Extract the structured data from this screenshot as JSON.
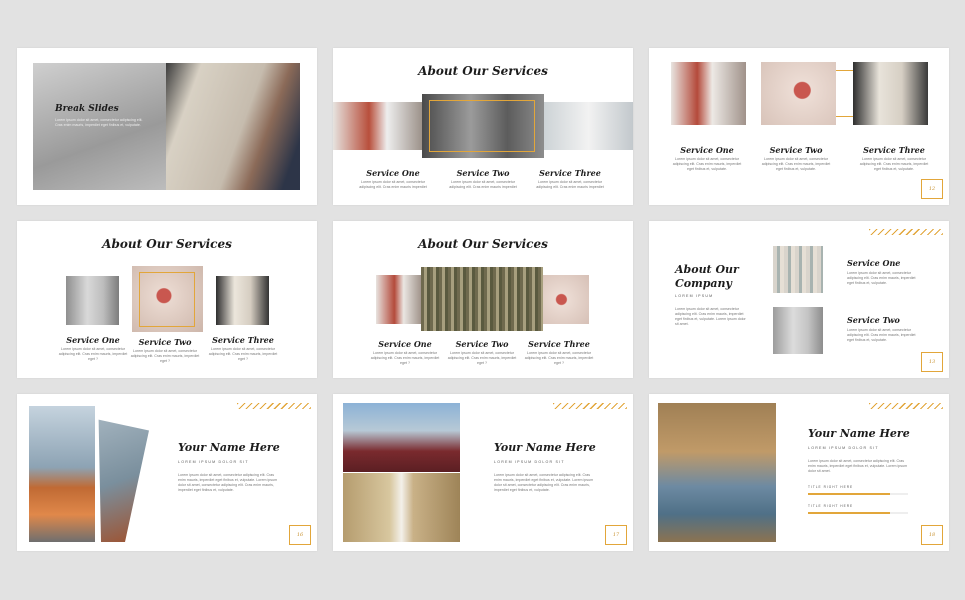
{
  "slides": {
    "s1": {
      "title": "Break Slides",
      "desc": "Lorem ipsum dolor sit amet, consectetur adipiscing elit. Cras enim mauris, imperdiet eget finibus et, vulputate."
    },
    "s2": {
      "title": "About Our Services",
      "services": [
        {
          "name": "Service One",
          "desc": "Lorem ipsum dolor sit amet, consectetur adipiscing elit. Cras enim mauris imperdiet"
        },
        {
          "name": "Service Two",
          "desc": "Lorem ipsum dolor sit amet, consectetur adipiscing elit. Cras enim mauris imperdiet"
        },
        {
          "name": "Service Three",
          "desc": "Lorem ipsum dolor sit amet, consectetur adipiscing elit. Cras enim mauris imperdiet"
        }
      ]
    },
    "s3": {
      "page": "12",
      "services": [
        {
          "name": "Service One",
          "desc": "Lorem ipsum dolor sit amet, consectetur adipiscing elit. Cras enim mauris, imperdiet eget finibus et, vulputate."
        },
        {
          "name": "Service Two",
          "desc": "Lorem ipsum dolor sit amet, consectetur adipiscing elit. Cras enim mauris, imperdiet eget finibus et, vulputate."
        },
        {
          "name": "Service Three",
          "desc": "Lorem ipsum dolor sit amet, consectetur adipiscing elit. Cras enim mauris, imperdiet eget finibus et, vulputate."
        }
      ]
    },
    "s4": {
      "title": "About Our Services",
      "services": [
        {
          "name": "Service One",
          "desc": "Lorem ipsum dolor sit amet, consectetur adipiscing elit. Cras enim mauris, imperdiet eget ?"
        },
        {
          "name": "Service Two",
          "desc": "Lorem ipsum dolor sit amet, consectetur adipiscing elit. Cras enim mauris, imperdiet eget ?"
        },
        {
          "name": "Service Three",
          "desc": "Lorem ipsum dolor sit amet, consectetur adipiscing elit. Cras enim mauris, imperdiet eget ?"
        }
      ]
    },
    "s5": {
      "title": "About Our Services",
      "services": [
        {
          "name": "Service One",
          "desc": "Lorem ipsum dolor sit amet, consectetur adipiscing elit. Cras enim mauris, imperdiet eget ?"
        },
        {
          "name": "Service Two",
          "desc": "Lorem ipsum dolor sit amet, consectetur adipiscing elit. Cras enim mauris, imperdiet eget ?"
        },
        {
          "name": "Service Three",
          "desc": "Lorem ipsum dolor sit amet, consectetur adipiscing elit. Cras enim mauris, imperdiet eget ?"
        }
      ]
    },
    "s6": {
      "title_line1": "About Our",
      "title_line2": "Company",
      "subtitle": "LOREM IPSUM",
      "desc": "Lorem ipsum dolor sit amet, consectetur adipiscing elit. Cras enim mauris, imperdiet eget finibus et, vulputate. Lorem ipsum dolor sit amet.",
      "page": "13",
      "services": [
        {
          "name": "Service One",
          "desc": "Lorem ipsum dolor sit amet, consectetur adipiscing elit. Cras enim mauris, imperdiet eget finibus et, vulputate."
        },
        {
          "name": "Service Two",
          "desc": "Lorem ipsum dolor sit amet, consectetur adipiscing elit. Cras enim mauris, imperdiet eget finibus et, vulputate."
        }
      ]
    },
    "s7": {
      "name": "Your Name Here",
      "subtitle": "LOREM IPSUM DOLOR SIT",
      "desc": "Lorem ipsum dolor sit amet, consectetur adipiscing elit. Cras enim mauris, imperdiet eget finibus et, vulputate. Lorem ipsum dolor sit amet, consectetur adipiscing elit. Cras enim mauris, imperdiet eget finibus et, vulputate.",
      "page": "16"
    },
    "s8": {
      "name": "Your Name Here",
      "subtitle": "LOREM IPSUM DOLOR SIT",
      "desc": "Lorem ipsum dolor sit amet, consectetur adipiscing elit. Cras enim mauris, imperdiet eget finibus et, vulputate. Lorem ipsum dolor sit amet, consectetur adipiscing elit. Cras enim mauris, imperdiet eget finibus et, vulputate.",
      "page": "17"
    },
    "s9": {
      "name": "Your Name Here",
      "subtitle": "LOREM IPSUM DOLOR SIT",
      "desc": "Lorem ipsum dolor sit amet, consectetur adipiscing elit. Cras enim mauris, imperdiet eget finibus et, vulputate. Lorem ipsum dolor sit amet.",
      "page": "18",
      "bars": [
        {
          "label": "TITLE RIGHT HERE",
          "level": 0.82
        },
        {
          "label": "TITLE RIGHT HERE",
          "level": 0.82
        }
      ]
    }
  },
  "colors": {
    "accent": "#e2a63a",
    "text": "#1c1c1c",
    "bg": "#e2e2e2"
  }
}
